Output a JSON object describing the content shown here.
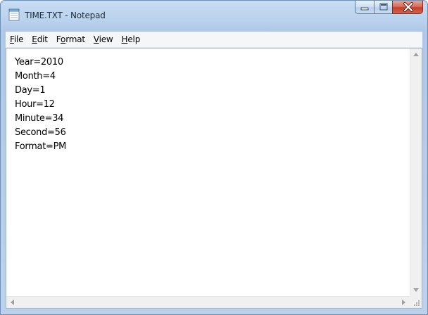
{
  "window": {
    "title": "TIME.TXT - Notepad"
  },
  "menu": {
    "file": {
      "accel": "F",
      "rest": "ile"
    },
    "edit": {
      "accel": "E",
      "rest": "dit"
    },
    "format": {
      "accel": "o",
      "pre": "F",
      "rest": "rmat"
    },
    "view": {
      "accel": "V",
      "rest": "iew"
    },
    "help": {
      "accel": "H",
      "rest": "elp"
    }
  },
  "document": {
    "lines": [
      "Year=2010",
      "Month=4",
      "Day=1",
      "Hour=12",
      "Minute=34",
      "Second=56",
      "Format=PM"
    ]
  },
  "icons": {
    "app": "notepad-icon",
    "minimize": "minimize-icon",
    "maximize": "maximize-icon",
    "close": "close-icon"
  },
  "colors": {
    "close_button": "#c2402a",
    "title_bar": "#b9d1ec"
  }
}
